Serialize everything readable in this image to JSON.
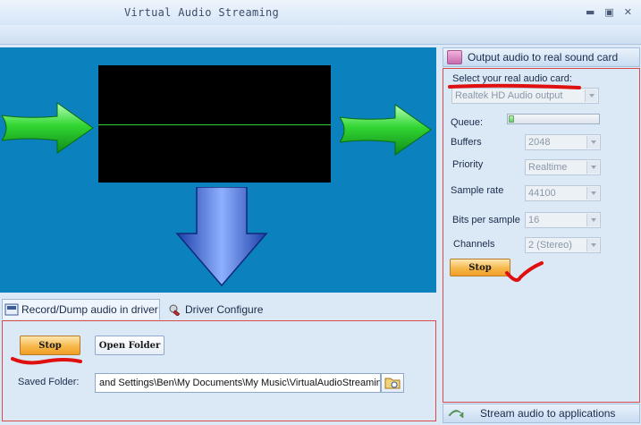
{
  "window": {
    "title": "Virtual Audio Streaming",
    "minimize": "▬",
    "maximize": "▣",
    "close": "✕"
  },
  "record_tab": {
    "label": "Record/Dump audio in driver",
    "stop_label": "Stop",
    "open_folder_label": "Open Folder",
    "saved_folder_label": "Saved Folder:",
    "saved_folder_value": "and Settings\\Ben\\My Documents\\My Music\\VirtualAudioStreaming"
  },
  "driver_tab": {
    "label": "Driver Configure"
  },
  "output_panel": {
    "title": "Output audio to real sound card",
    "select_card_label": "Select your real audio card:",
    "audio_card_value": "Realtek HD Audio output",
    "queue_label": "Queue:",
    "queue_fill": 0.05,
    "buffers_label": "Buffers",
    "buffers_value": "2048",
    "priority_label": "Priority",
    "priority_value": "Realtime",
    "sample_rate_label": "Sample rate",
    "sample_rate_value": "44100",
    "bits_label": "Bits per sample",
    "bits_value": "16",
    "channels_label": "Channels",
    "channels_value": "2 (Stereo)",
    "stop_label": "Stop"
  },
  "stream_panel": {
    "title": "Stream audio to applications"
  },
  "colors": {
    "viz_background": "#0b82bd",
    "arrow_green": "#2fd12f",
    "arrow_blue": "#2f5fd0",
    "annotation_red": "#e01010"
  }
}
